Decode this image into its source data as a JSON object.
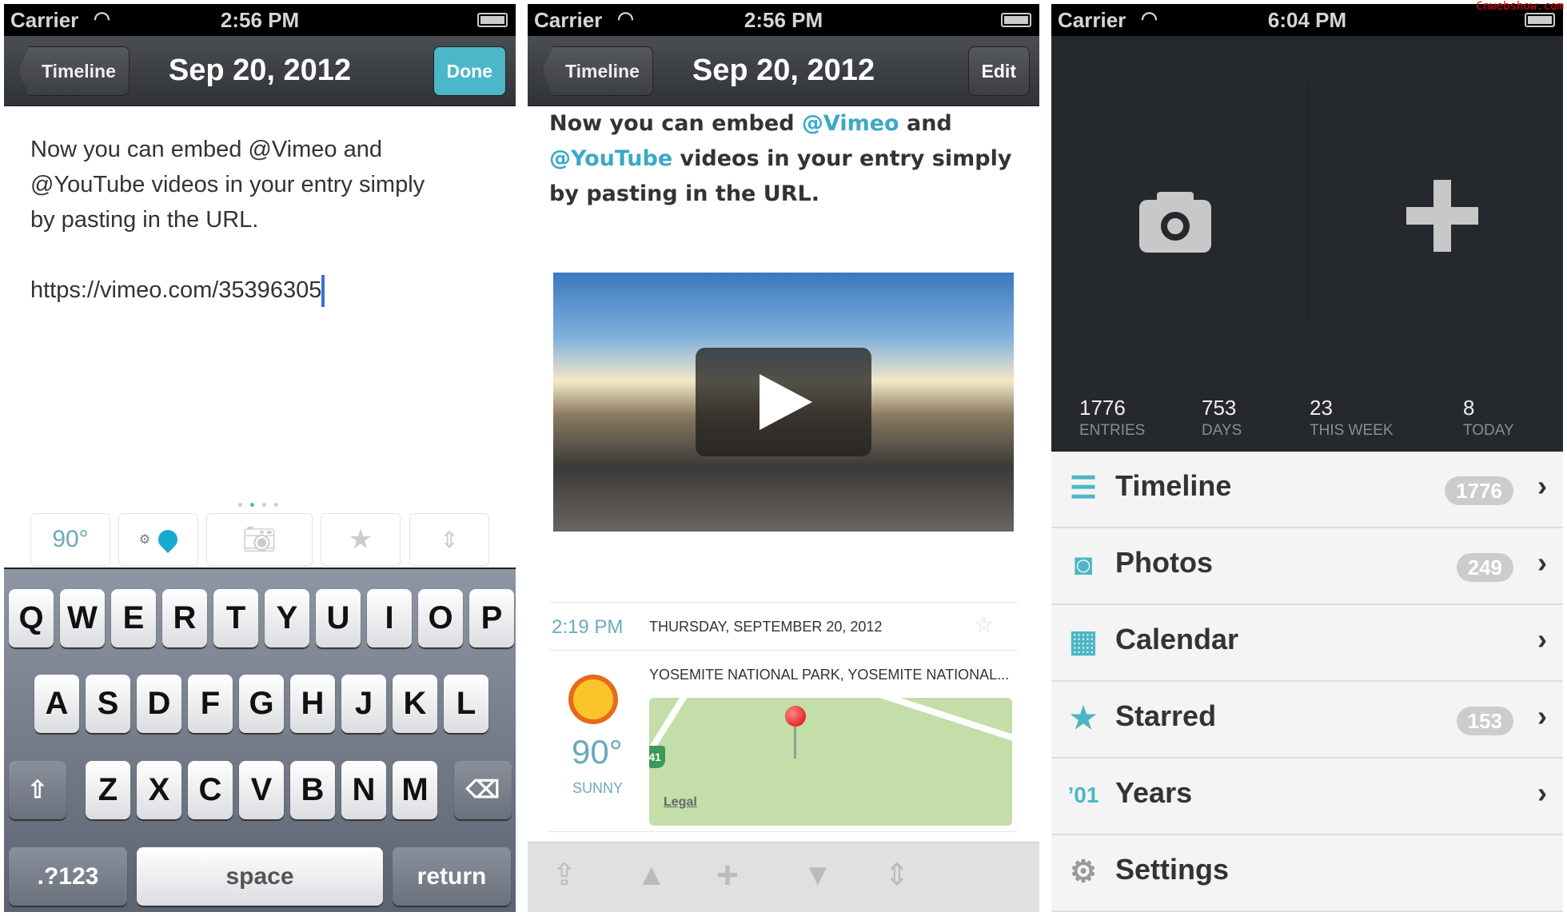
{
  "watermark": "Cnwebshow.com",
  "colors": {
    "accent": "#4db6c6",
    "nav_dark": "#2f3236",
    "done": "#4bb7c8"
  },
  "editor": {
    "status": {
      "carrier": "Carrier",
      "time": "2:56 PM"
    },
    "nav": {
      "back": "Timeline",
      "title": "Sep 20, 2012",
      "action": "Done"
    },
    "text_lines": [
      "Now you can embed @Vimeo and",
      "@YouTube videos in your entry simply",
      "by pasting in the URL."
    ],
    "url": "https://vimeo.com/35396305",
    "page_dots": {
      "count": 4,
      "active": 2
    },
    "toolbar": {
      "weather": "90°",
      "icons": [
        "location-pin-icon",
        "camera-icon",
        "star-icon",
        "expand-icon"
      ]
    },
    "keyboard": {
      "row1": [
        "Q",
        "W",
        "E",
        "R",
        "T",
        "Y",
        "U",
        "I",
        "O",
        "P"
      ],
      "row2": [
        "A",
        "S",
        "D",
        "F",
        "G",
        "H",
        "J",
        "K",
        "L"
      ],
      "row3": [
        "Z",
        "X",
        "C",
        "V",
        "B",
        "N",
        "M"
      ],
      "numbers": ".?123",
      "space": "space",
      "return": "return"
    }
  },
  "entry": {
    "status": {
      "carrier": "Carrier",
      "time": "2:56 PM"
    },
    "nav": {
      "back": "Timeline",
      "title": "Sep 20, 2012",
      "action": "Edit"
    },
    "text": {
      "p1": "Now you can embed ",
      "link1": "@Vimeo",
      "p2": " and ",
      "link2": "@YouTube",
      "p3": " videos in your entry simply by pasting in the URL."
    },
    "time": "2:19 PM",
    "date": "THURSDAY, SEPTEMBER 20, 2012",
    "location": "YOSEMITE NATIONAL PARK, YOSEMITE NATIONAL...",
    "weather": {
      "temp": "90°",
      "condition": "SUNNY"
    },
    "map": {
      "legal": "Legal",
      "route": "41"
    }
  },
  "menu": {
    "status": {
      "carrier": "Carrier",
      "time": "6:04 PM"
    },
    "stats": [
      {
        "value": "1776",
        "label": "ENTRIES"
      },
      {
        "value": "753",
        "label": "DAYS"
      },
      {
        "value": "23",
        "label": "THIS WEEK"
      },
      {
        "value": "8",
        "label": "TODAY"
      }
    ],
    "items": [
      {
        "label": "Timeline",
        "badge": "1776",
        "icon": "☰"
      },
      {
        "label": "Photos",
        "badge": "249",
        "icon": "◙"
      },
      {
        "label": "Calendar",
        "badge": "",
        "icon": "▦"
      },
      {
        "label": "Starred",
        "badge": "153",
        "icon": "★"
      },
      {
        "label": "Years",
        "badge": "",
        "icon": "’01"
      },
      {
        "label": "Settings",
        "badge": "",
        "icon": "⚙"
      }
    ]
  }
}
